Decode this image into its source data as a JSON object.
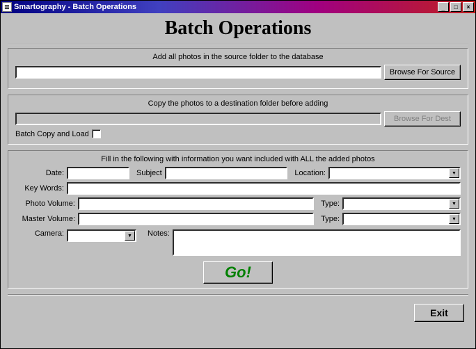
{
  "window": {
    "title": "Smartography - Batch Operations",
    "minimize": "_",
    "maximize": "□",
    "close": "×"
  },
  "page": {
    "heading": "Batch Operations"
  },
  "source": {
    "caption": "Add all photos in the source folder to the database",
    "path": "",
    "browse": "Browse For Source"
  },
  "dest": {
    "caption": "Copy the photos to a destination  folder before adding",
    "path": "",
    "browse": "Browse For Dest",
    "batch_copy_label": "Batch Copy and Load",
    "batch_copy_checked": false
  },
  "info": {
    "caption": "Fill in the following  with information you want included with ALL the added photos",
    "date_label": "Date:",
    "date": "",
    "subject_label": "Subject",
    "subject": "",
    "location_label": "Location:",
    "location": "",
    "keywords_label": "Key Words:",
    "keywords": "",
    "photo_volume_label": "Photo Volume:",
    "photo_volume": "",
    "photo_type_label": "Type:",
    "photo_type": "",
    "master_volume_label": "Master Volume:",
    "master_volume": "",
    "master_type_label": "Type:",
    "master_type": "",
    "camera_label": "Camera:",
    "camera": "",
    "notes_label": "Notes:",
    "notes": ""
  },
  "actions": {
    "go": "Go!",
    "exit": "Exit"
  }
}
